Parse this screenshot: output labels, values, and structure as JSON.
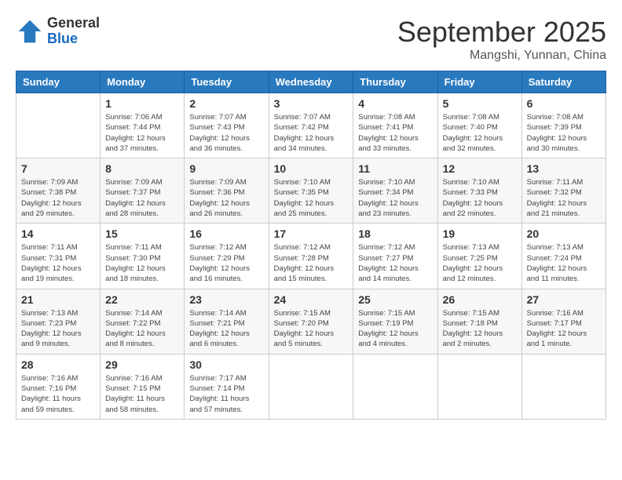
{
  "header": {
    "logo_general": "General",
    "logo_blue": "Blue",
    "month_title": "September 2025",
    "location": "Mangshi, Yunnan, China"
  },
  "days_of_week": [
    "Sunday",
    "Monday",
    "Tuesday",
    "Wednesday",
    "Thursday",
    "Friday",
    "Saturday"
  ],
  "weeks": [
    [
      {
        "day": "",
        "info": ""
      },
      {
        "day": "1",
        "info": "Sunrise: 7:06 AM\nSunset: 7:44 PM\nDaylight: 12 hours\nand 37 minutes."
      },
      {
        "day": "2",
        "info": "Sunrise: 7:07 AM\nSunset: 7:43 PM\nDaylight: 12 hours\nand 36 minutes."
      },
      {
        "day": "3",
        "info": "Sunrise: 7:07 AM\nSunset: 7:42 PM\nDaylight: 12 hours\nand 34 minutes."
      },
      {
        "day": "4",
        "info": "Sunrise: 7:08 AM\nSunset: 7:41 PM\nDaylight: 12 hours\nand 33 minutes."
      },
      {
        "day": "5",
        "info": "Sunrise: 7:08 AM\nSunset: 7:40 PM\nDaylight: 12 hours\nand 32 minutes."
      },
      {
        "day": "6",
        "info": "Sunrise: 7:08 AM\nSunset: 7:39 PM\nDaylight: 12 hours\nand 30 minutes."
      }
    ],
    [
      {
        "day": "7",
        "info": "Sunrise: 7:09 AM\nSunset: 7:38 PM\nDaylight: 12 hours\nand 29 minutes."
      },
      {
        "day": "8",
        "info": "Sunrise: 7:09 AM\nSunset: 7:37 PM\nDaylight: 12 hours\nand 28 minutes."
      },
      {
        "day": "9",
        "info": "Sunrise: 7:09 AM\nSunset: 7:36 PM\nDaylight: 12 hours\nand 26 minutes."
      },
      {
        "day": "10",
        "info": "Sunrise: 7:10 AM\nSunset: 7:35 PM\nDaylight: 12 hours\nand 25 minutes."
      },
      {
        "day": "11",
        "info": "Sunrise: 7:10 AM\nSunset: 7:34 PM\nDaylight: 12 hours\nand 23 minutes."
      },
      {
        "day": "12",
        "info": "Sunrise: 7:10 AM\nSunset: 7:33 PM\nDaylight: 12 hours\nand 22 minutes."
      },
      {
        "day": "13",
        "info": "Sunrise: 7:11 AM\nSunset: 7:32 PM\nDaylight: 12 hours\nand 21 minutes."
      }
    ],
    [
      {
        "day": "14",
        "info": "Sunrise: 7:11 AM\nSunset: 7:31 PM\nDaylight: 12 hours\nand 19 minutes."
      },
      {
        "day": "15",
        "info": "Sunrise: 7:11 AM\nSunset: 7:30 PM\nDaylight: 12 hours\nand 18 minutes."
      },
      {
        "day": "16",
        "info": "Sunrise: 7:12 AM\nSunset: 7:29 PM\nDaylight: 12 hours\nand 16 minutes."
      },
      {
        "day": "17",
        "info": "Sunrise: 7:12 AM\nSunset: 7:28 PM\nDaylight: 12 hours\nand 15 minutes."
      },
      {
        "day": "18",
        "info": "Sunrise: 7:12 AM\nSunset: 7:27 PM\nDaylight: 12 hours\nand 14 minutes."
      },
      {
        "day": "19",
        "info": "Sunrise: 7:13 AM\nSunset: 7:25 PM\nDaylight: 12 hours\nand 12 minutes."
      },
      {
        "day": "20",
        "info": "Sunrise: 7:13 AM\nSunset: 7:24 PM\nDaylight: 12 hours\nand 11 minutes."
      }
    ],
    [
      {
        "day": "21",
        "info": "Sunrise: 7:13 AM\nSunset: 7:23 PM\nDaylight: 12 hours\nand 9 minutes."
      },
      {
        "day": "22",
        "info": "Sunrise: 7:14 AM\nSunset: 7:22 PM\nDaylight: 12 hours\nand 8 minutes."
      },
      {
        "day": "23",
        "info": "Sunrise: 7:14 AM\nSunset: 7:21 PM\nDaylight: 12 hours\nand 6 minutes."
      },
      {
        "day": "24",
        "info": "Sunrise: 7:15 AM\nSunset: 7:20 PM\nDaylight: 12 hours\nand 5 minutes."
      },
      {
        "day": "25",
        "info": "Sunrise: 7:15 AM\nSunset: 7:19 PM\nDaylight: 12 hours\nand 4 minutes."
      },
      {
        "day": "26",
        "info": "Sunrise: 7:15 AM\nSunset: 7:18 PM\nDaylight: 12 hours\nand 2 minutes."
      },
      {
        "day": "27",
        "info": "Sunrise: 7:16 AM\nSunset: 7:17 PM\nDaylight: 12 hours\nand 1 minute."
      }
    ],
    [
      {
        "day": "28",
        "info": "Sunrise: 7:16 AM\nSunset: 7:16 PM\nDaylight: 11 hours\nand 59 minutes."
      },
      {
        "day": "29",
        "info": "Sunrise: 7:16 AM\nSunset: 7:15 PM\nDaylight: 11 hours\nand 58 minutes."
      },
      {
        "day": "30",
        "info": "Sunrise: 7:17 AM\nSunset: 7:14 PM\nDaylight: 11 hours\nand 57 minutes."
      },
      {
        "day": "",
        "info": ""
      },
      {
        "day": "",
        "info": ""
      },
      {
        "day": "",
        "info": ""
      },
      {
        "day": "",
        "info": ""
      }
    ]
  ]
}
